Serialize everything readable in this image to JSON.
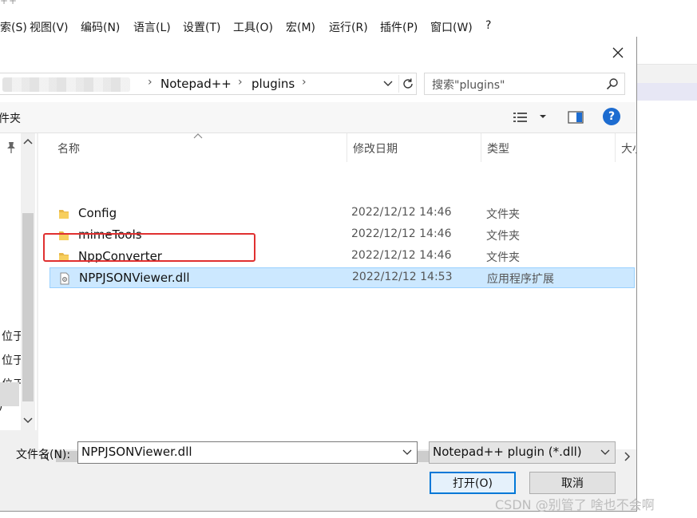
{
  "app": {
    "title_fragment": "++"
  },
  "menubar": {
    "items": [
      "索(S)",
      "视图(V)",
      "编码(N)",
      "语言(L)",
      "设置(T)",
      "工具(O)",
      "宏(M)",
      "运行(R)",
      "插件(P)",
      "窗口(W)",
      "?"
    ]
  },
  "dialog": {
    "breadcrumb": [
      "Notepad++",
      "plugins"
    ],
    "search_placeholder": "搜索\"plugins\"",
    "toolbar": {
      "new_folder_label": "件夹",
      "help_label": "?"
    },
    "nav_pane": {
      "items": [
        "位于",
        "位于",
        "位于",
        ")"
      ]
    },
    "columns": {
      "name": "名称",
      "date": "修改日期",
      "type": "类型",
      "size": "大小"
    },
    "files": [
      {
        "name": "Config",
        "date": "2022/12/12 14:46",
        "type": "文件夹",
        "kind": "folder"
      },
      {
        "name": "mimeTools",
        "date": "2022/12/12 14:46",
        "type": "文件夹",
        "kind": "folder"
      },
      {
        "name": "NppConverter",
        "date": "2022/12/12 14:46",
        "type": "文件夹",
        "kind": "folder"
      },
      {
        "name": "NPPJSONViewer.dll",
        "date": "2022/12/12 14:53",
        "type": "应用程序扩展",
        "kind": "dll",
        "selected": true
      }
    ],
    "filename_label": "文件名(N):",
    "filename_value": "NPPJSONViewer.dll",
    "filetype_value": "Notepad++ plugin (*.dll)",
    "open_button": "打开(O)",
    "cancel_button": "取消",
    "colors": {
      "selection": "#cce8ff",
      "highlight_box": "#e03030",
      "accent": "#0078d7"
    }
  },
  "watermark": "CSDN @别管了 啥也不会啊"
}
